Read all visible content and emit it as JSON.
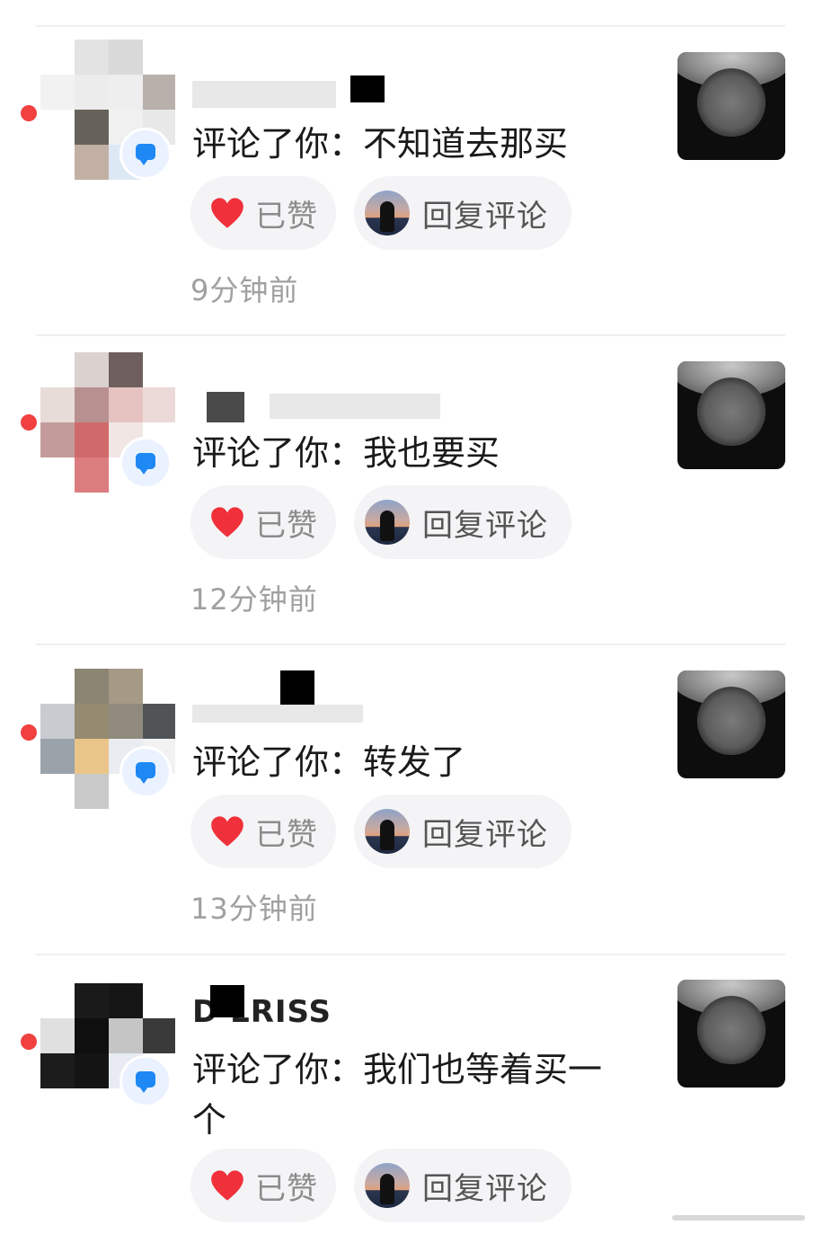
{
  "colors": {
    "unread_dot": "#f04040",
    "heart": "#f0303a",
    "badge_bubble": "#1e88f5",
    "button_bg": "#f4f4f6",
    "time_text": "#a0a0a0"
  },
  "notifications": [
    {
      "username": "",
      "comment_prefix": "评论了你：",
      "comment_text": "不知道去那买",
      "like_label": "已赞",
      "reply_label": "回复评论",
      "time": "9分钟前",
      "badge_icon": "comment-bubble-icon"
    },
    {
      "username": "",
      "comment_prefix": "评论了你：",
      "comment_text": "我也要买",
      "like_label": "已赞",
      "reply_label": "回复评论",
      "time": "12分钟前",
      "badge_icon": "comment-bubble-icon"
    },
    {
      "username": "",
      "comment_prefix": "评论了你：",
      "comment_text": "转发了",
      "like_label": "已赞",
      "reply_label": "回复评论",
      "time": "13分钟前",
      "badge_icon": "comment-bubble-icon"
    },
    {
      "username": "D LRISS",
      "comment_prefix": "评论了你：",
      "comment_text": "我们也等着买一个",
      "like_label": "已赞",
      "reply_label": "回复评论",
      "time": "",
      "badge_icon": "comment-bubble-icon"
    }
  ]
}
